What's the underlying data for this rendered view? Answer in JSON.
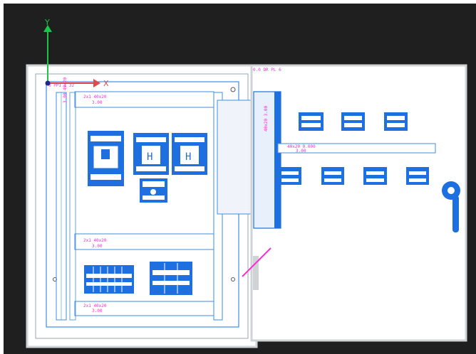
{
  "colors": {
    "background": "#1f1f1f",
    "cabinet_outline": "#cfd3d6",
    "panel": "#ffffff",
    "rail": "#3d8ee6",
    "device": "#1e6fe0",
    "annotation": "#ff2bd6",
    "axis_y": "#21c24a",
    "axis_x": "#e04a4a"
  },
  "ucs": {
    "y_axis_label": "Y",
    "x_axis_label": "X",
    "icon_name": "ucs-icon"
  },
  "annotations": {
    "origin_note": "0 PPI 1 32",
    "top_rail_a": "2x1 40x20",
    "top_rail_b": "3.00",
    "left_rail": "3.00 40x20",
    "mid_rail_a": "2x1 40x20",
    "mid_rail_b": "3.00",
    "bottom_rail_a": "2x1 40x20",
    "bottom_rail_b": "3.00",
    "door_title": "0.0 DR PL 6",
    "door_vertical": "40x20 3.00",
    "door_bar_a": "40x20 0.000",
    "door_bar_b": "3.00"
  }
}
